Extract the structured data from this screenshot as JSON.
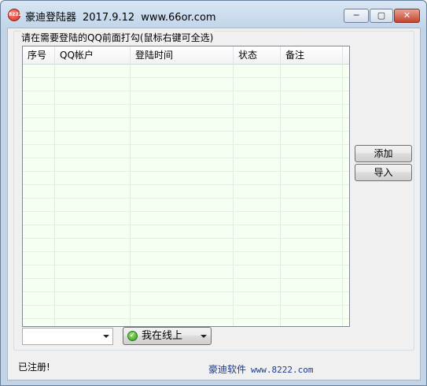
{
  "window": {
    "icon_text": "8222",
    "title": "豪迪登陆器",
    "version": "2017.9.12",
    "site": "www.66or.com",
    "controls": {
      "minimize": "─",
      "maximize": "▢",
      "close": "✕"
    }
  },
  "group": {
    "label": "请在需要登陆的QQ前面打勾(鼠标右键可全选)"
  },
  "table": {
    "columns": [
      "序号",
      "QQ帐户",
      "登陆时间",
      "状态",
      "备注"
    ],
    "rows": []
  },
  "buttons": {
    "add": "添加",
    "import": "导入"
  },
  "account_select": {
    "value": ""
  },
  "status_select": {
    "value": "我在线上",
    "icon": "online-check-icon"
  },
  "footer": {
    "registered": "已注册!",
    "brand": "豪迪软件",
    "url": "www.8222.com"
  },
  "colors": {
    "title_bar": "#c2d5ea",
    "list_background": "#f5fff2",
    "close_button": "#c4442f",
    "brand_text": "#1a3a8a",
    "status_online": "#2f9a1d"
  }
}
